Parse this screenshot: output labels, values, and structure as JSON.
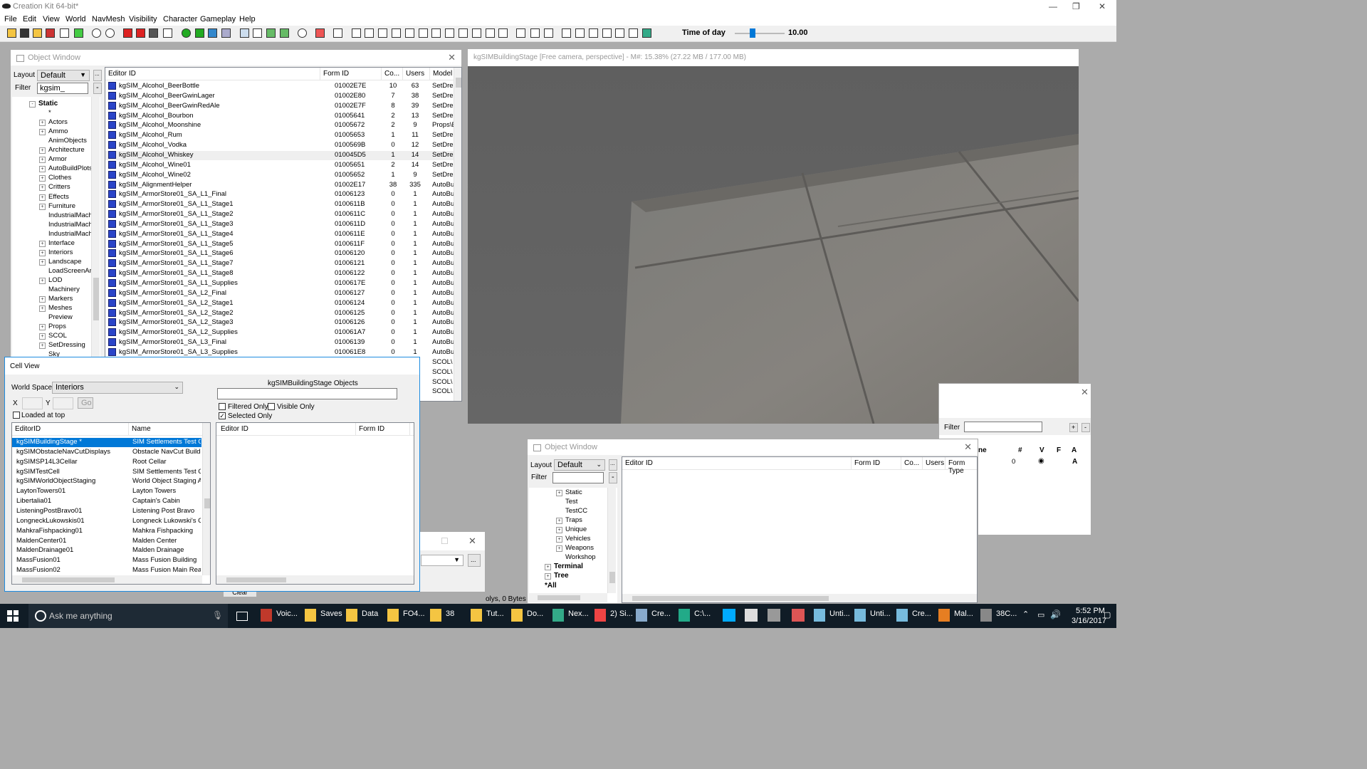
{
  "app": {
    "title": "Creation Kit 64-bit*"
  },
  "menu": [
    "File",
    "Edit",
    "View",
    "World",
    "NavMesh",
    "Visibility",
    "Character",
    "Gameplay",
    "Help"
  ],
  "time_of_day": {
    "label": "Time of day",
    "value": "10.00",
    "slider_fraction": 0.35
  },
  "object_window": {
    "title": "Object Window",
    "layout_label": "Layout",
    "layout_value": "Default",
    "filter_label": "Filter",
    "filter_value": "kgsim_",
    "dots_btn": "...",
    "dash_btn": "-",
    "tree": [
      {
        "label": "Static",
        "bold": true,
        "expand": "-"
      },
      {
        "label": "*",
        "expand": ""
      },
      {
        "label": "Actors",
        "expand": "+"
      },
      {
        "label": "Ammo",
        "expand": "+"
      },
      {
        "label": "AnimObjects",
        "expand": ""
      },
      {
        "label": "Architecture",
        "expand": "+"
      },
      {
        "label": "Armor",
        "expand": "+"
      },
      {
        "label": "AutoBuildPlots",
        "expand": "+"
      },
      {
        "label": "Clothes",
        "expand": "+"
      },
      {
        "label": "Critters",
        "expand": "+"
      },
      {
        "label": "Effects",
        "expand": "+"
      },
      {
        "label": "Furniture",
        "expand": "+"
      },
      {
        "label": "IndustrialMachi",
        "expand": ""
      },
      {
        "label": "IndustrialMachi",
        "expand": ""
      },
      {
        "label": "IndustrialMachi",
        "expand": ""
      },
      {
        "label": "Interface",
        "expand": "+"
      },
      {
        "label": "Interiors",
        "expand": "+"
      },
      {
        "label": "Landscape",
        "expand": "+"
      },
      {
        "label": "LoadScreenArt",
        "expand": ""
      },
      {
        "label": "LOD",
        "expand": "+"
      },
      {
        "label": "Machinery",
        "expand": ""
      },
      {
        "label": "Markers",
        "expand": "+"
      },
      {
        "label": "Meshes",
        "expand": "+"
      },
      {
        "label": "Preview",
        "expand": ""
      },
      {
        "label": "Props",
        "expand": "+"
      },
      {
        "label": "SCOL",
        "expand": "+"
      },
      {
        "label": "SetDressing",
        "expand": "+"
      },
      {
        "label": "Sky",
        "expand": ""
      }
    ],
    "columns": [
      "Editor ID",
      "Form ID",
      "Co...",
      "Users",
      "Model"
    ],
    "rows": [
      [
        "kgSIM_Alcohol_BeerBottle",
        "01002E7E",
        "10",
        "63",
        "SetDre:"
      ],
      [
        "kgSIM_Alcohol_BeerGwinLager",
        "01002E80",
        "7",
        "38",
        "SetDre:"
      ],
      [
        "kgSIM_Alcohol_BeerGwinRedAle",
        "01002E7F",
        "8",
        "39",
        "SetDre:"
      ],
      [
        "kgSIM_Alcohol_Bourbon",
        "01005641",
        "2",
        "13",
        "SetDre:"
      ],
      [
        "kgSIM_Alcohol_Moonshine",
        "01005672",
        "2",
        "9",
        "Props\\E"
      ],
      [
        "kgSIM_Alcohol_Rum",
        "01005653",
        "1",
        "11",
        "SetDre:"
      ],
      [
        "kgSIM_Alcohol_Vodka",
        "0100569B",
        "0",
        "12",
        "SetDre:"
      ],
      [
        "kgSIM_Alcohol_Whiskey",
        "010045D5",
        "1",
        "14",
        "SetDre:"
      ],
      [
        "kgSIM_Alcohol_Wine01",
        "01005651",
        "2",
        "14",
        "SetDre:"
      ],
      [
        "kgSIM_Alcohol_Wine02",
        "01005652",
        "1",
        "9",
        "SetDre:"
      ],
      [
        "kgSIM_AlignmentHelper",
        "01002E17",
        "38",
        "335",
        "AutoBu"
      ],
      [
        "kgSIM_ArmorStore01_SA_L1_Final",
        "01006123",
        "0",
        "1",
        "AutoBu"
      ],
      [
        "kgSIM_ArmorStore01_SA_L1_Stage1",
        "0100611B",
        "0",
        "1",
        "AutoBu"
      ],
      [
        "kgSIM_ArmorStore01_SA_L1_Stage2",
        "0100611C",
        "0",
        "1",
        "AutoBu"
      ],
      [
        "kgSIM_ArmorStore01_SA_L1_Stage3",
        "0100611D",
        "0",
        "1",
        "AutoBu"
      ],
      [
        "kgSIM_ArmorStore01_SA_L1_Stage4",
        "0100611E",
        "0",
        "1",
        "AutoBu"
      ],
      [
        "kgSIM_ArmorStore01_SA_L1_Stage5",
        "0100611F",
        "0",
        "1",
        "AutoBu"
      ],
      [
        "kgSIM_ArmorStore01_SA_L1_Stage6",
        "01006120",
        "0",
        "1",
        "AutoBu"
      ],
      [
        "kgSIM_ArmorStore01_SA_L1_Stage7",
        "01006121",
        "0",
        "1",
        "AutoBu"
      ],
      [
        "kgSIM_ArmorStore01_SA_L1_Stage8",
        "01006122",
        "0",
        "1",
        "AutoBu"
      ],
      [
        "kgSIM_ArmorStore01_SA_L1_Supplies",
        "0100617E",
        "0",
        "1",
        "AutoBu"
      ],
      [
        "kgSIM_ArmorStore01_SA_L2_Final",
        "01006127",
        "0",
        "1",
        "AutoBu"
      ],
      [
        "kgSIM_ArmorStore01_SA_L2_Stage1",
        "01006124",
        "0",
        "1",
        "AutoBu"
      ],
      [
        "kgSIM_ArmorStore01_SA_L2_Stage2",
        "01006125",
        "0",
        "1",
        "AutoBu"
      ],
      [
        "kgSIM_ArmorStore01_SA_L2_Stage3",
        "01006126",
        "0",
        "1",
        "AutoBu"
      ],
      [
        "kgSIM_ArmorStore01_SA_L2_Supplies",
        "010061A7",
        "0",
        "1",
        "AutoBu"
      ],
      [
        "kgSIM_ArmorStore01_SA_L3_Final",
        "01006139",
        "0",
        "1",
        "AutoBu"
      ],
      [
        "kgSIM_ArmorStore01_SA_L3_Supplies",
        "010061E8",
        "0",
        "1",
        "AutoBu"
      ]
    ],
    "extra_models": [
      "SCOL\\",
      "SCOL\\",
      "SCOL\\",
      "SCOL\\"
    ]
  },
  "viewport": {
    "title": "kgSIMBuildingStage [Free camera, perspective] - M#: 15.38% (27.22 MB / 177.00 MB)"
  },
  "cell_view": {
    "title": "Cell View",
    "world_space_label": "World Space",
    "world_space_value": "Interiors",
    "x_label": "X",
    "y_label": "Y",
    "go_btn": "Go",
    "loaded_at_top": "Loaded at top",
    "objects_title": "kgSIMBuildingStage Objects",
    "filtered_only": "Filtered Only",
    "visible_only": "Visible Only",
    "selected_only": "Selected Only",
    "cols_left": [
      "EditorID",
      "Name"
    ],
    "cols_right": [
      "Editor ID",
      "Form ID"
    ],
    "cells": [
      [
        "kgSIMBuildingStage *",
        "SIM Settlements Test Ce"
      ],
      [
        "kgSIMObstacleNavCutDisplays",
        "Obstacle NavCut Build C"
      ],
      [
        "kgSIMSP14L3Cellar",
        "Root Cellar"
      ],
      [
        "kgSIMTestCell",
        "SIM Settlements Test Ce"
      ],
      [
        "kgSIMWorldObjectStaging",
        "World Object Staging Ar"
      ],
      [
        "LaytonTowers01",
        "Layton Towers"
      ],
      [
        "Libertalia01",
        "Captain's Cabin"
      ],
      [
        "ListeningPostBravo01",
        "Listening Post Bravo"
      ],
      [
        "LongneckLukowskis01",
        "Longneck Lukowski's Ca"
      ],
      [
        "MahkraFishpacking01",
        "Mahkra Fishpacking"
      ],
      [
        "MaldenCenter01",
        "Malden Center"
      ],
      [
        "MaldenDrainage01",
        "Malden Drainage"
      ],
      [
        "MassFusion01",
        "Mass Fusion Building"
      ],
      [
        "MassFusion02",
        "Mass Fusion Main React"
      ]
    ]
  },
  "object_window2": {
    "title": "Object Window",
    "layout_label": "Layout",
    "layout_value": "Default",
    "filter_label": "Filter",
    "dots_btn": "...",
    "dash_btn": "-",
    "tree": [
      {
        "label": "Static",
        "bold": false,
        "expand": "+"
      },
      {
        "label": "Test",
        "bold": false,
        "expand": ""
      },
      {
        "label": "TestCC",
        "bold": false,
        "expand": ""
      },
      {
        "label": "Traps",
        "bold": false,
        "expand": "+"
      },
      {
        "label": "Unique",
        "bold": false,
        "expand": "+"
      },
      {
        "label": "Vehicles",
        "bold": false,
        "expand": "+"
      },
      {
        "label": "Weapons",
        "bold": false,
        "expand": "+"
      },
      {
        "label": "Workshop",
        "bold": false,
        "expand": ""
      },
      {
        "label": "Terminal",
        "bold": true,
        "expand": "+"
      },
      {
        "label": "Tree",
        "bold": true,
        "expand": "+"
      },
      {
        "label": "*All",
        "bold": true,
        "expand": ""
      }
    ],
    "columns": [
      "Editor ID",
      "Form ID",
      "Co...",
      "Users",
      "Form Type"
    ]
  },
  "layer_window": {
    "filter_label": "Filter",
    "cols": [
      "ne",
      "#",
      "V",
      "F",
      "A"
    ],
    "row": [
      "0",
      "A"
    ]
  },
  "statusbar": {
    "text": "olys, 0 Bytes t"
  },
  "clear_btn": "Clear",
  "taskbar": {
    "search": "Ask me anything",
    "items": [
      "Voic...",
      "Saves",
      "Data",
      "FO4...",
      "38",
      "Tut...",
      "Do...",
      "Nex...",
      "2) Si...",
      "Cre...",
      "C:\\...",
      "",
      "",
      "",
      "",
      "Unti...",
      "Unti...",
      "Cre...",
      "Mal...",
      "38C..."
    ],
    "time": "5:52 PM",
    "date": "3/16/2017"
  }
}
